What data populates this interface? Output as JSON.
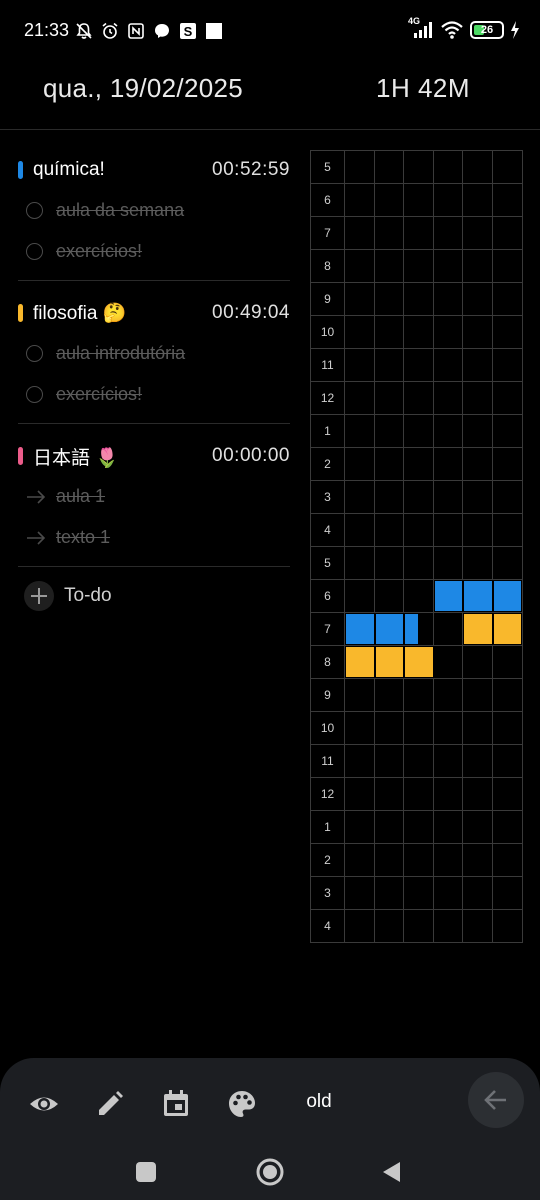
{
  "status_bar": {
    "time": "21:33",
    "network": "4G",
    "battery": "26",
    "icons": [
      "muted-bell-icon",
      "alarm-icon",
      "nfc-icon",
      "messenger-icon",
      "s-app-icon",
      "square-app-icon",
      "signal-icon",
      "wifi-icon",
      "battery-icon",
      "charging-icon"
    ]
  },
  "header": {
    "date": "qua., 19/02/2025",
    "total": "1H 42M"
  },
  "groups": [
    {
      "name": "química!",
      "time": "00:52:59",
      "color": "#1e88e5",
      "items": [
        {
          "label": "aula da semana",
          "done": true,
          "marker": "circle-icon"
        },
        {
          "label": "exercícios!",
          "done": true,
          "marker": "circle-icon"
        }
      ]
    },
    {
      "name": "filosofia 🤔",
      "time": "00:49:04",
      "color": "#f9b82c",
      "items": [
        {
          "label": "aula introdutória",
          "done": true,
          "marker": "circle-icon"
        },
        {
          "label": "exercícios!",
          "done": true,
          "marker": "circle-icon"
        }
      ]
    },
    {
      "name": "日本語 🌷",
      "time": "00:00:00",
      "color": "#ec5c8a",
      "items": [
        {
          "label": "aula 1",
          "done": true,
          "marker": "arrow-right-icon"
        },
        {
          "label": "texto 1",
          "done": true,
          "marker": "arrow-right-icon"
        }
      ]
    }
  ],
  "todo": {
    "label": "To-do"
  },
  "timeline": {
    "hours": [
      "5",
      "6",
      "7",
      "8",
      "9",
      "10",
      "11",
      "12",
      "1",
      "2",
      "3",
      "4",
      "5",
      "6",
      "7",
      "8",
      "9",
      "10",
      "11",
      "12",
      "1",
      "2",
      "3",
      "4"
    ],
    "blocks": [
      {
        "hour_index": 13,
        "start_fraction": 0.5,
        "end_fraction": 1.0,
        "color": "#1e88e5"
      },
      {
        "hour_index": 14,
        "start_fraction": 0.0,
        "end_fraction": 0.4167,
        "color": "#1e88e5"
      },
      {
        "hour_index": 14,
        "start_fraction": 0.6667,
        "end_fraction": 1.0,
        "color": "#f9b82c"
      },
      {
        "hour_index": 15,
        "start_fraction": 0.0,
        "end_fraction": 0.5167,
        "color": "#f9b82c"
      }
    ]
  },
  "bottom_bar": {
    "icons": [
      "eye-icon",
      "pencil-icon",
      "calendar-icon",
      "palette-icon"
    ],
    "old_label": "old",
    "back_icon": "arrow-left-icon"
  },
  "nav_bar": {
    "icons": [
      "recents-square-icon",
      "home-circle-icon",
      "back-triangle-icon"
    ]
  }
}
